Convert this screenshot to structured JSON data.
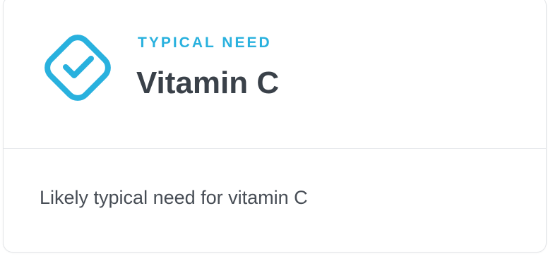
{
  "card": {
    "eyebrow": "TYPICAL NEED",
    "title": "Vitamin C",
    "description": "Likely typical need for vitamin C",
    "icon": "check-diamond-icon",
    "accent_color": "#29b1de",
    "title_color": "#3a4149"
  }
}
